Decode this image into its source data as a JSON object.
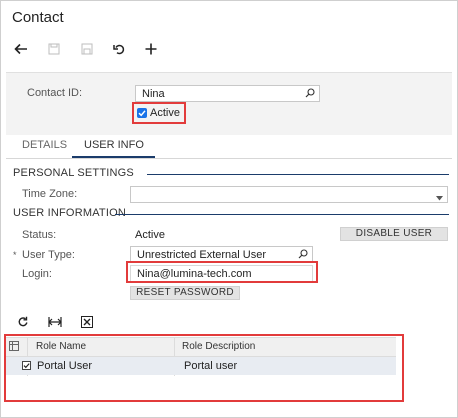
{
  "window": {
    "title": "Contact"
  },
  "toolbar": {
    "icons": [
      "back-arrow-icon",
      "save-icon",
      "save-close-icon",
      "undo-icon",
      "add-icon"
    ]
  },
  "header": {
    "contact_id_label": "Contact ID:",
    "contact_id_value": "Nina",
    "active_label": "Active",
    "active_checked": true
  },
  "tabs": [
    {
      "label": "DETAILS",
      "active": false
    },
    {
      "label": "USER INFO",
      "active": true
    }
  ],
  "personal_settings": {
    "title": "PERSONAL SETTINGS",
    "time_zone_label": "Time Zone:",
    "time_zone_value": ""
  },
  "user_information": {
    "title": "USER INFORMATION",
    "status_label": "Status:",
    "status_value": "Active",
    "disable_user_label": "DISABLE USER",
    "user_type_label": "User Type:",
    "user_type_required": "*",
    "user_type_value": "Unrestricted External User",
    "login_label": "Login:",
    "login_value": "Nina@lumina-tech.com",
    "reset_password_label": "RESET PASSWORD"
  },
  "roles_grid": {
    "toolbar_icons": [
      "refresh-icon",
      "fit-columns-icon",
      "export-excel-icon"
    ],
    "columns": [
      "Role Name",
      "Role Description"
    ],
    "rows": [
      {
        "selected": true,
        "role_name": "Portal User",
        "role_description": "Portal user"
      }
    ]
  },
  "colors": {
    "accent": "#1b3c6b",
    "highlight_box": "#e23b3b",
    "checkbox": "#1a73e8"
  }
}
